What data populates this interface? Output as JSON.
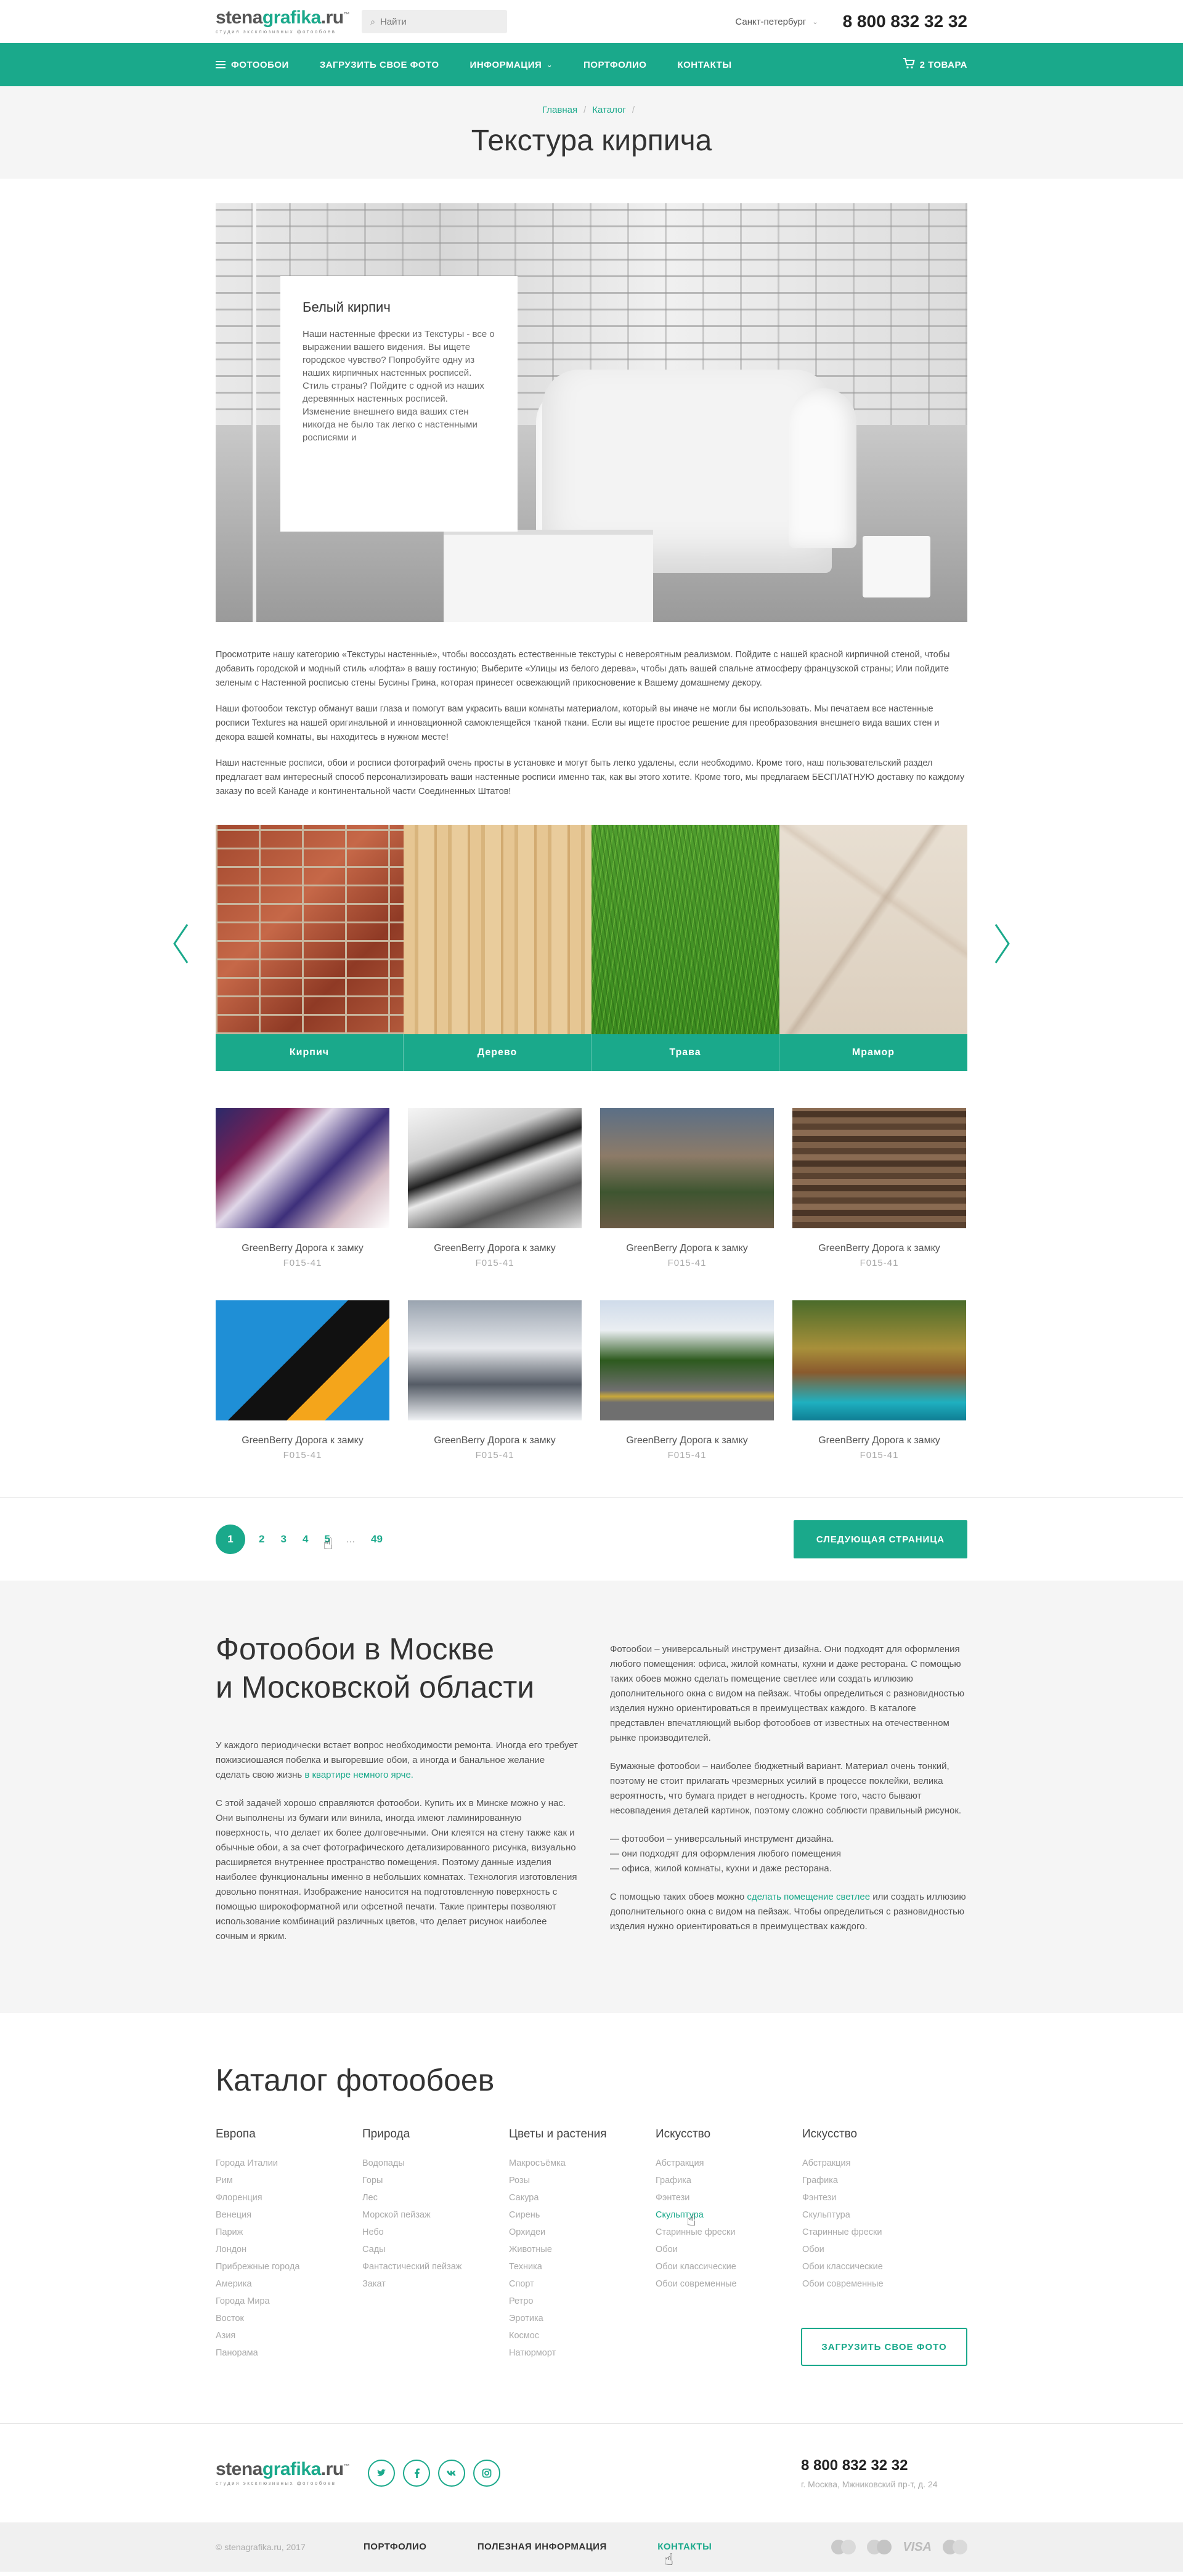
{
  "header": {
    "logo": {
      "part1": "stena",
      "part2": "grafika",
      "part3": ".ru",
      "tm": "™",
      "tagline": "студия эксклюзивных фотообоев"
    },
    "search": {
      "placeholder": "Найти"
    },
    "city": "Санкт-петербург",
    "phone": "8 800 832 32 32"
  },
  "nav": {
    "items": [
      "Фотообои",
      "Загрузить свое фото",
      "Информация",
      "Портфолио",
      "Контакты"
    ],
    "cart": "2 товара"
  },
  "breadcrumbs": [
    "Главная",
    "Каталог"
  ],
  "page_title": "Текстура кирпича",
  "hero": {
    "card_title": "Белый кирпич",
    "card_text": "Наши настенные фрески из Текстуры - все о выражении вашего видения. Вы ищете городское чувство? Попробуйте одну из наших кирпичных настенных росписей. Стиль страны? Пойдите с одной из наших деревянных настенных росписей. Изменение внешнего вида ваших стен никогда не было так легко с настенными росписями и"
  },
  "intro": [
    "Просмотрите нашу категорию «Текстуры настенные», чтобы воссоздать естественные текстуры с невероятным реализмом. Пойдите с нашей красной кирпичной стеной, чтобы добавить городской и модный стиль «лофта» в вашу гостиную; Выберите «Улицы из белого дерева», чтобы дать вашей спальне атмосферу французской страны; Или пойдите зеленым с Настенной росписью стены Бусины Грина, которая принесет освежающий прикосновение к Вашему домашнему декору.",
    "Наши фотообои текстур обманут ваши глаза и помогут вам украсить ваши комнаты материалом, который вы иначе не могли бы использовать. Мы печатаем все настенные росписи Textures на нашей оригинальной и инновационной самоклеящейся тканой ткани. Если вы ищете простое решение для преобразования внешнего вида ваших стен и декора вашей комнаты, вы находитесь в нужном месте!",
    "Наши настенные росписи, обои и росписи фотографий очень просты в установке и могут быть легко удалены, если необходимо. Кроме того, наш пользовательский раздел предлагает вам интересный способ персонализировать ваши настенные росписи именно так, как вы этого хотите. Кроме того, мы предлагаем БЕСПЛАТНУЮ доставку по каждому заказу по всей Канаде и континентальной части Соединенных Штатов!"
  ],
  "categories": [
    {
      "label": "Кирпич",
      "texture": "brick"
    },
    {
      "label": "Дерево",
      "texture": "wood"
    },
    {
      "label": "Трава",
      "texture": "grass"
    },
    {
      "label": "Мрамор",
      "texture": "marble"
    }
  ],
  "products": [
    {
      "name": "GreenBerry Дорога к замку",
      "sku": "F015-41"
    },
    {
      "name": "GreenBerry Дорога к замку",
      "sku": "F015-41"
    },
    {
      "name": "GreenBerry Дорога к замку",
      "sku": "F015-41"
    },
    {
      "name": "GreenBerry Дорога к замку",
      "sku": "F015-41"
    },
    {
      "name": "GreenBerry Дорога к замку",
      "sku": "F015-41"
    },
    {
      "name": "GreenBerry Дорога к замку",
      "sku": "F015-41"
    },
    {
      "name": "GreenBerry Дорога к замку",
      "sku": "F015-41"
    },
    {
      "name": "GreenBerry Дорога к замку",
      "sku": "F015-41"
    }
  ],
  "pager": {
    "pages": [
      "1",
      "2",
      "3",
      "4",
      "5"
    ],
    "current": "1",
    "ellipsis": "...",
    "last": "49",
    "next_label": "Следующая страница"
  },
  "seo": {
    "title_line1": "Фотообои в Москве",
    "title_line2": "и Московской области",
    "left_p1_a": "У каждого периодически встает вопрос необходимости ремонта. Иногда его требует пожизсиошаяся побелка и выгоревшие обои, а иногда и банальное желание сделать свою жизнь ",
    "left_p1_link": "в квартире немного ярче.",
    "left_p2": "С этой задачей хорошо справляются фотообои. Купить их в Минске можно у нас. Они выполнены из бумаги или винила, иногда имеют ламинированную поверхность, что делает их более долговечными. Они клеятся на стену также как и обычные обои, а за счет фотографического детализированного рисунка, визуально расширяется внутреннее пространство помещения. Поэтому данные изделия наиболее функциональны именно в небольших комнатах. Технология изготовления довольно понятная. Изображение наносится на подготовленную поверхность с помощью широкоформатной или офсетной печати. Такие принтеры позволяют использование комбинаций различных цветов, что делает рисунок наиболее сочным и ярким.",
    "right_p1": "Фотообои – универсальный инструмент дизайна. Они подходят для оформления любого помещения: офиса, жилой комнаты, кухни и даже ресторана. С помощью таких обоев можно сделать помещение светлее или создать иллюзию дополнительного окна с видом на пейзаж. Чтобы определиться с разновидностью изделия нужно ориентироваться в преимуществах каждого. В каталоге представлен впечатляющий выбор фотообоев от известных на отечественном рынке производителей.",
    "right_p2": "Бумажные фотообои – наиболее бюджетный вариант. Материал очень тонкий, поэтому не стоит прилагать чрезмерных усилий в процессе поклейки, велика вероятность, что бумага придет в негодность. Кроме того, часто бывают несовпадения деталей картинок, поэтому сложно соблюсти правильный рисунок.",
    "right_list": [
      "— фотообои – универсальный инструмент дизайна.",
      "— они подходят для оформления любого помещения",
      "— офиса, жилой комнаты, кухни и даже ресторана."
    ],
    "right_p3_a": "С помощью таких обоев можно ",
    "right_p3_link": "сделать помещение светлее",
    "right_p3_b": " или создать иллюзию дополнительного окна с видом на пейзаж. Чтобы определиться с разновидностью изделия нужно ориентироваться в преимуществах каждого."
  },
  "catalog": {
    "title": "Каталог фотообоев",
    "columns": [
      {
        "title": "Европа",
        "items": [
          "Города Италии",
          "Рим",
          "Флоренция",
          "Венеция",
          "Париж",
          "Лондон",
          "Прибрежные города",
          "Америка",
          "Города Мира",
          "Восток",
          "Азия",
          "Панорама"
        ]
      },
      {
        "title": "Природа",
        "items": [
          "Водопады",
          "Горы",
          "Лес",
          "Морской пейзаж",
          "Небо",
          "Сады",
          "Фантастический пейзаж",
          "Закат"
        ]
      },
      {
        "title": "Цветы и растения",
        "items": [
          "Макросъёмка",
          "Розы",
          "Сакура",
          "Сирень",
          "Орхидеи",
          "Животные",
          "Техника",
          "Спорт",
          "Ретро",
          "Эротика",
          "Космос",
          "Натюрморт"
        ]
      },
      {
        "title": "Искусство",
        "items": [
          "Абстракция",
          "Графика",
          "Фэнтези",
          "Скульптура",
          "Старинные фрески",
          "Обои",
          "Обои классические",
          "Обои современные"
        ],
        "active_index": 3
      },
      {
        "title": "Искусство",
        "items": [
          "Абстракция",
          "Графика",
          "Фэнтези",
          "Скульптура",
          "Старинные фрески",
          "Обои",
          "Обои классические",
          "Обои современные"
        ]
      }
    ],
    "upload_button": "Загрузить свое фото"
  },
  "footer": {
    "socials": [
      "twitter-icon",
      "facebook-icon",
      "vk-icon",
      "instagram-icon"
    ],
    "phone": "8 800 832 32 32",
    "address": "г. Москва, Мжниковский пр-т, д. 24",
    "copyright": "© stenagrafika.ru, 2017",
    "links": [
      "Портфолио",
      "Полезная информация",
      "Контакты"
    ],
    "active_link": "Контакты",
    "payments": [
      "mastercard-icon",
      "maestro-icon",
      "visa-icon",
      "mastercard-alt-icon"
    ],
    "visa_text": "VISA"
  },
  "colors": {
    "accent": "#1aa98b",
    "band": "#f5f5f5",
    "text": "#444444"
  }
}
